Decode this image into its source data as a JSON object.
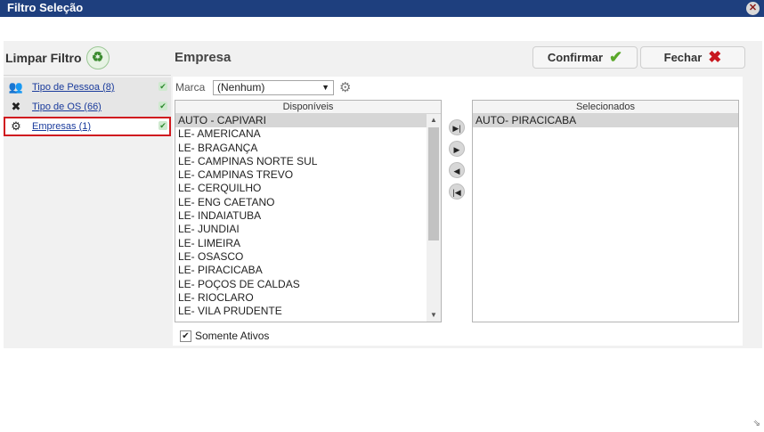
{
  "window": {
    "title": "Filtro Seleção",
    "close_icon": "close-icon"
  },
  "left": {
    "clear_label": "Limpar Filtro",
    "clear_icon": "recycle-icon",
    "items": [
      {
        "label": "Tipo de Pessoa (8)",
        "icon": "people-icon",
        "check": "check-icon"
      },
      {
        "label": "Tipo de OS (66)",
        "icon": "tools-icon",
        "check": "check-icon"
      },
      {
        "label": "Empresas (1)",
        "icon": "gear-icon",
        "check": "check-icon"
      }
    ]
  },
  "section_title": "Empresa",
  "buttons": {
    "confirm": "Confirmar",
    "confirm_icon": "checkmark-icon",
    "close": "Fechar",
    "close_icon": "x-icon"
  },
  "marca": {
    "label": "Marca",
    "value": "(Nenhum)"
  },
  "available": {
    "header": "Disponíveis",
    "items": [
      "AUTO - CAPIVARI",
      "LE- AMERICANA",
      "LE- BRAGANÇA",
      "LE- CAMPINAS NORTE SUL",
      "LE- CAMPINAS TREVO",
      "LE- CERQUILHO",
      "LE- ENG CAETANO",
      "LE- INDAIATUBA",
      "LE- JUNDIAI",
      "LE- LIMEIRA",
      "LE- OSASCO",
      "LE- PIRACICABA",
      "LE- POÇOS DE CALDAS",
      "LE- RIOCLARO",
      "LE- VILA PRUDENTE"
    ]
  },
  "selected": {
    "header": "Selecionados",
    "items": [
      "AUTO- PIRACICABA"
    ]
  },
  "move_buttons": [
    "move-all-right-icon",
    "move-right-icon",
    "move-left-icon",
    "move-all-left-icon"
  ],
  "only_active": {
    "label": "Somente Ativos",
    "checked": true
  },
  "colors": {
    "titlebar": "#1e3f7e",
    "highlight_border": "#d0191f",
    "confirm_check": "#5aa82a",
    "close_x": "#c8181e"
  }
}
